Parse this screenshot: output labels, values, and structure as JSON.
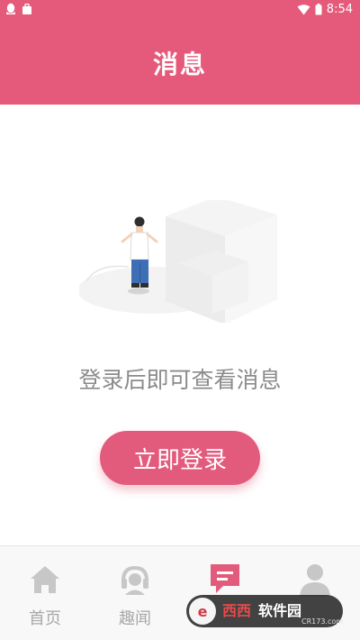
{
  "status_bar": {
    "time": "8:54"
  },
  "header": {
    "title": "消息"
  },
  "empty_state": {
    "message": "登录后即可查看消息",
    "login_button_label": "立即登录"
  },
  "tabs": [
    {
      "label": "首页",
      "icon": "home-icon",
      "active": false
    },
    {
      "label": "趣闻",
      "icon": "headset-icon",
      "active": false
    },
    {
      "label": "",
      "icon": "message-icon",
      "active": true
    },
    {
      "label": "",
      "icon": "user-icon",
      "active": false
    }
  ],
  "watermark": {
    "brand": "西西软件园",
    "url": "CR173.com"
  },
  "colors": {
    "accent": "#e35b7c",
    "header": "#e55a7a",
    "inactive": "#a8a8a8"
  }
}
